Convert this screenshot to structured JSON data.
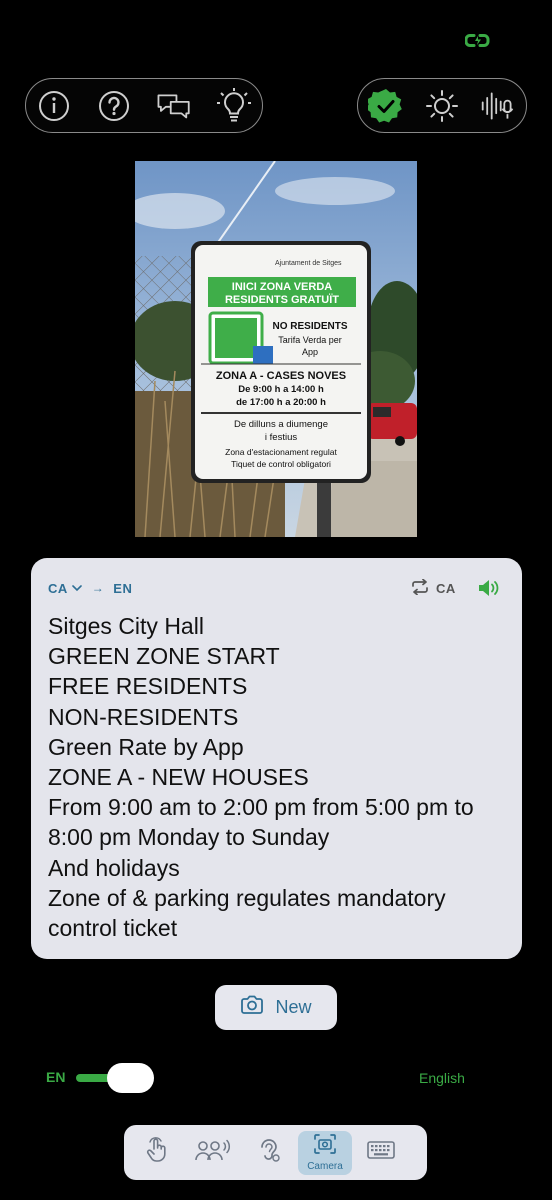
{
  "status_bar": {
    "battery_icon": "battery-charging-icon",
    "battery_color": "#3aaa45"
  },
  "top_left_pill": {
    "icons": [
      "info-icon",
      "help-icon",
      "chat-bubbles-icon",
      "lightbulb-icon"
    ]
  },
  "top_right_pill": {
    "icons": [
      "verified-check-icon",
      "brightness-icon",
      "voice-mic-icon"
    ],
    "verified_color": "#3aaa45"
  },
  "photo": {
    "sign": {
      "header": "Ajuntament de Sitges",
      "green_banner_line1": "INICI ZONA VERDA",
      "green_banner_line2": "RESIDENTS GRATUÏT",
      "no_residents": "NO RESIDENTS",
      "tarifa_line1": "Tarifa Verda per",
      "tarifa_line2": "App",
      "zona": "ZONA A - CASES NOVES",
      "hours1": "De 9:00 h a 14:00 h",
      "hours2": "de 17:00 h a 20:00 h",
      "days1": "De dilluns a diumenge",
      "days2": "i festius",
      "zone_note1": "Zona d'estacionament regulat",
      "zone_note2": "Tiquet de control obligatori"
    }
  },
  "translation_card": {
    "source_lang": "CA",
    "arrow": "→",
    "target_lang": "EN",
    "detected_lang": "CA",
    "lines": [
      "Sitges City Hall",
      "GREEN ZONE START",
      "FREE RESIDENTS",
      "NON-RESIDENTS",
      "Green Rate by App",
      "ZONE A - NEW HOUSES",
      "From 9:00 am to 2:00 pm from 5:00 pm to 8:00 pm Monday to Sunday",
      "And holidays",
      "Zone of & parking regulates mandatory control ticket"
    ],
    "accent_color": "#2e6f95"
  },
  "new_button": {
    "label": "New",
    "icon": "camera-icon"
  },
  "language_toggle": {
    "code": "EN",
    "name": "English",
    "on": true
  },
  "tabbar": {
    "tabs": [
      {
        "icon": "hand-tap-icon",
        "label": ""
      },
      {
        "icon": "conversation-icon",
        "label": ""
      },
      {
        "icon": "hearing-icon",
        "label": ""
      },
      {
        "icon": "camera-scan-icon",
        "label": "Camera",
        "active": true
      },
      {
        "icon": "keyboard-icon",
        "label": ""
      }
    ]
  }
}
